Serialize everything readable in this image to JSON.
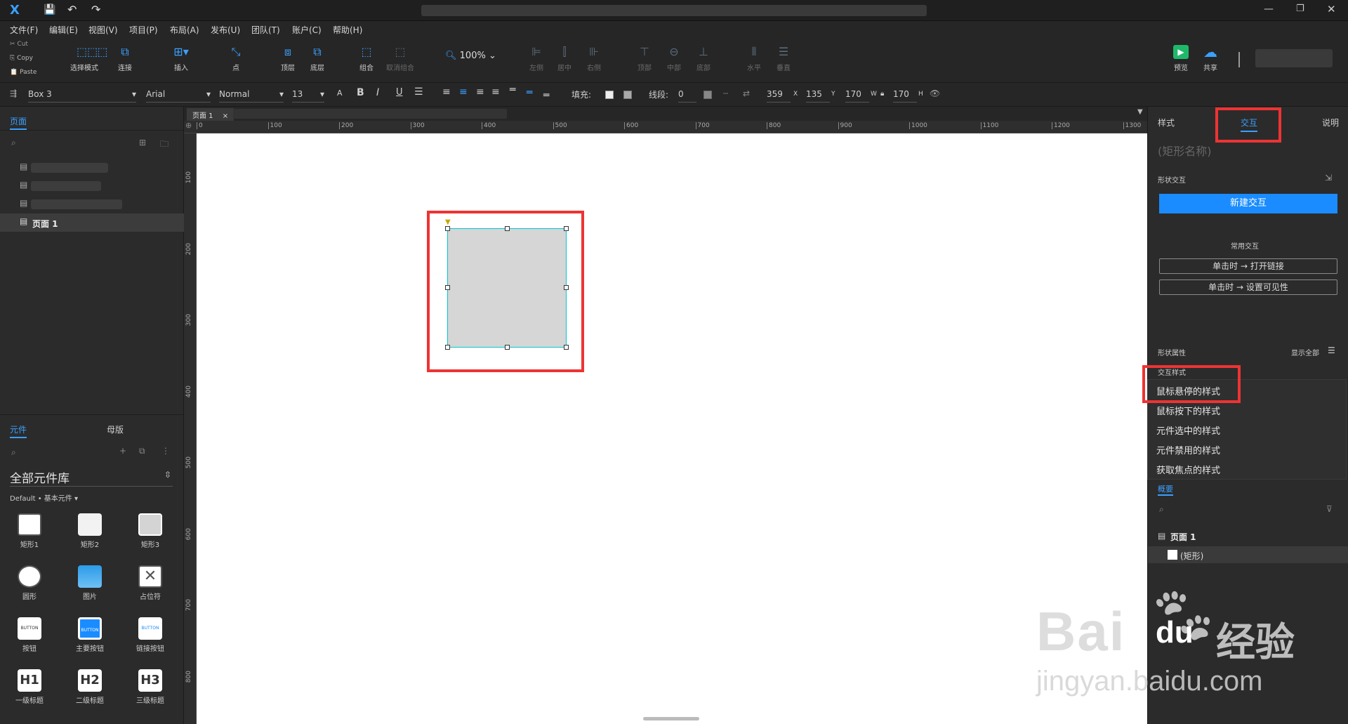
{
  "titlebar": {
    "logo": "X"
  },
  "menu": [
    "文件(F)",
    "编辑(E)",
    "视图(V)",
    "项目(P)",
    "布局(A)",
    "发布(U)",
    "团队(T)",
    "账户(C)",
    "帮助(H)"
  ],
  "clipboard": {
    "cut": "Cut",
    "copy": "Copy",
    "paste": "Paste"
  },
  "toolbar": {
    "select_mode": "选择模式",
    "connect": "连接",
    "insert": "插入",
    "point": "点",
    "top_layer": "顶层",
    "bottom_layer": "底层",
    "group": "组合",
    "ungroup": "取消组合",
    "zoom": "100%",
    "align_left": "左侧",
    "align_center": "居中",
    "align_right": "右侧",
    "align_top": "顶部",
    "align_middle": "中部",
    "align_bottom": "底部",
    "horizontal": "水平",
    "vertical": "垂直",
    "preview": "预览",
    "share": "共享"
  },
  "format": {
    "widget_name": "Box 3",
    "font": "Arial",
    "style": "Normal",
    "size": "13",
    "fill_label": "填充:",
    "stroke_label": "线段:",
    "stroke_value": "0",
    "x": "359",
    "x_label": "X",
    "y": "135",
    "y_label": "Y",
    "w": "170",
    "w_label": "W",
    "h": "170",
    "h_label": "H"
  },
  "left": {
    "pages_tab": "页面",
    "page1": "页面 1",
    "widgets_tab": "元件",
    "masters_tab": "母版",
    "library_title": "全部元件库",
    "library_sub": "Default • 基本元件 ▾",
    "widgets": [
      "矩形1",
      "矩形2",
      "矩形3",
      "圆形",
      "图片",
      "占位符",
      "按钮",
      "主要按钮",
      "链接按钮",
      "一级标题",
      "二级标题",
      "三级标题"
    ],
    "button_text": "BUTTON",
    "h1": "H1",
    "h2": "H2",
    "h3": "H3"
  },
  "canvas": {
    "tab": "页面 1",
    "ruler_top": [
      "0",
      "100",
      "200",
      "300",
      "400",
      "500",
      "600",
      "700",
      "800",
      "900",
      "1000",
      "1100",
      "1200",
      "1300"
    ],
    "ruler_left": [
      "100",
      "200",
      "300",
      "400",
      "500",
      "600",
      "700",
      "800"
    ]
  },
  "right": {
    "tab_style": "样式",
    "tab_interact": "交互",
    "tab_notes": "说明",
    "shape_name_placeholder": "(矩形名称)",
    "shape_interact": "形状交互",
    "new_interaction": "新建交互",
    "common_interactions": "常用交互",
    "on_click_link": "单击时 → 打开链接",
    "on_click_visible": "单击时 → 设置可见性",
    "shape_props": "形状属性",
    "show_all": "显示全部",
    "interaction_styles": "交互样式",
    "dropdown": [
      "鼠标悬停的样式",
      "鼠标按下的样式",
      "元件选中的样式",
      "元件禁用的样式",
      "获取焦点的样式"
    ],
    "outline_tab": "概要",
    "outline_page": "页面 1",
    "outline_item": "(矩形)"
  },
  "watermark": {
    "brand": "Bai",
    "brand2": "du",
    "cn": "经验",
    "url": "jingyan.baidu.com"
  },
  "colors": {
    "accent": "#1a8cff",
    "highlight": "#ee3333",
    "selection": "#00c8d4"
  }
}
